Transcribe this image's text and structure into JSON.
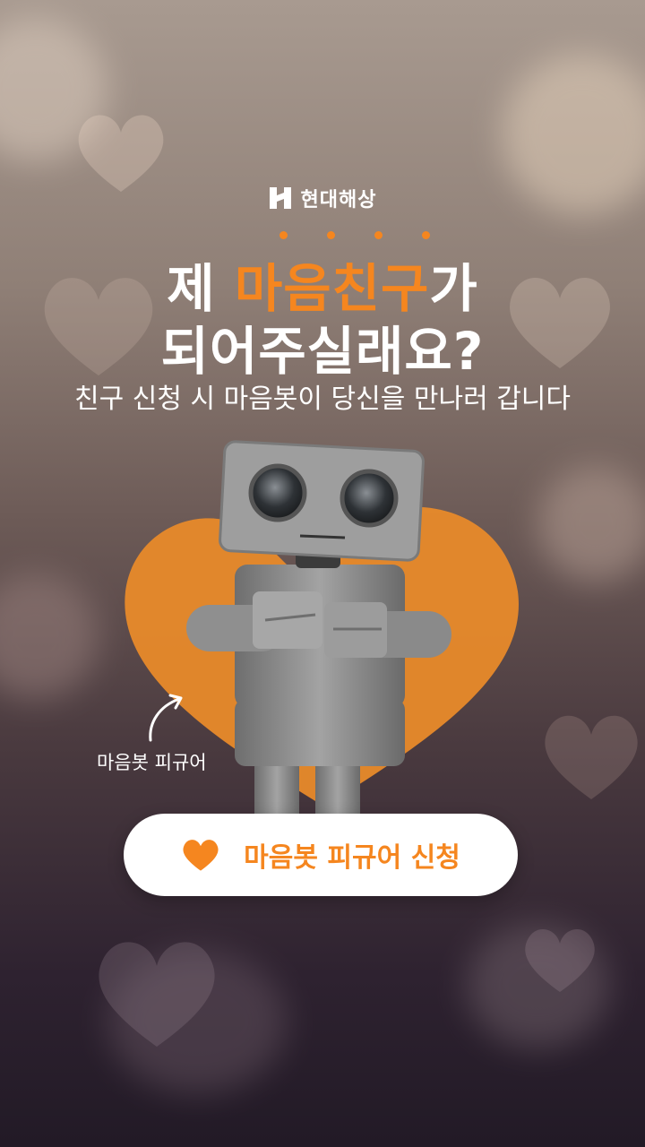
{
  "brand": {
    "name": "현대해상",
    "logo_icon": "hyundai-h-logo-icon"
  },
  "headline": {
    "line1_prefix": "제 ",
    "line1_highlight": "마음친구",
    "line1_suffix": "가",
    "line2": "되어주실래요?"
  },
  "subtitle": "친구 신청 시 마음봇이 당신을 만나러 갑니다",
  "figure_label": "마음봇 피규어",
  "cta": {
    "label": "마음봇 피규어 신청",
    "icon": "heart-icon"
  },
  "colors": {
    "accent": "#f5861f",
    "text": "#ffffff",
    "button_bg": "#ffffff"
  }
}
